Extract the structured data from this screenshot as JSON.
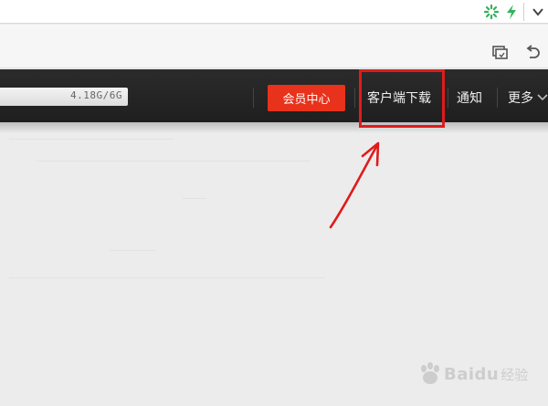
{
  "header": {
    "storage_text": "4.18G/6G",
    "vip_label": "会员中心",
    "client_download_label": "客户端下载",
    "notify_label": "通知",
    "more_label": "更多"
  },
  "icons": {
    "loading": "loading-spinner-icon",
    "lightning": "lightning-icon",
    "chevron": "chevron-down-icon",
    "screenshot": "screenshot-icon",
    "undo": "undo-icon"
  },
  "colors": {
    "header_bg": "#222222",
    "vip_bg": "#e8321b",
    "highlight": "#e01b1b",
    "spinner": "#2fb45a",
    "lightning": "#2fb45a"
  },
  "watermark": {
    "logo_text": "Baidu",
    "sub_text": "经验"
  }
}
